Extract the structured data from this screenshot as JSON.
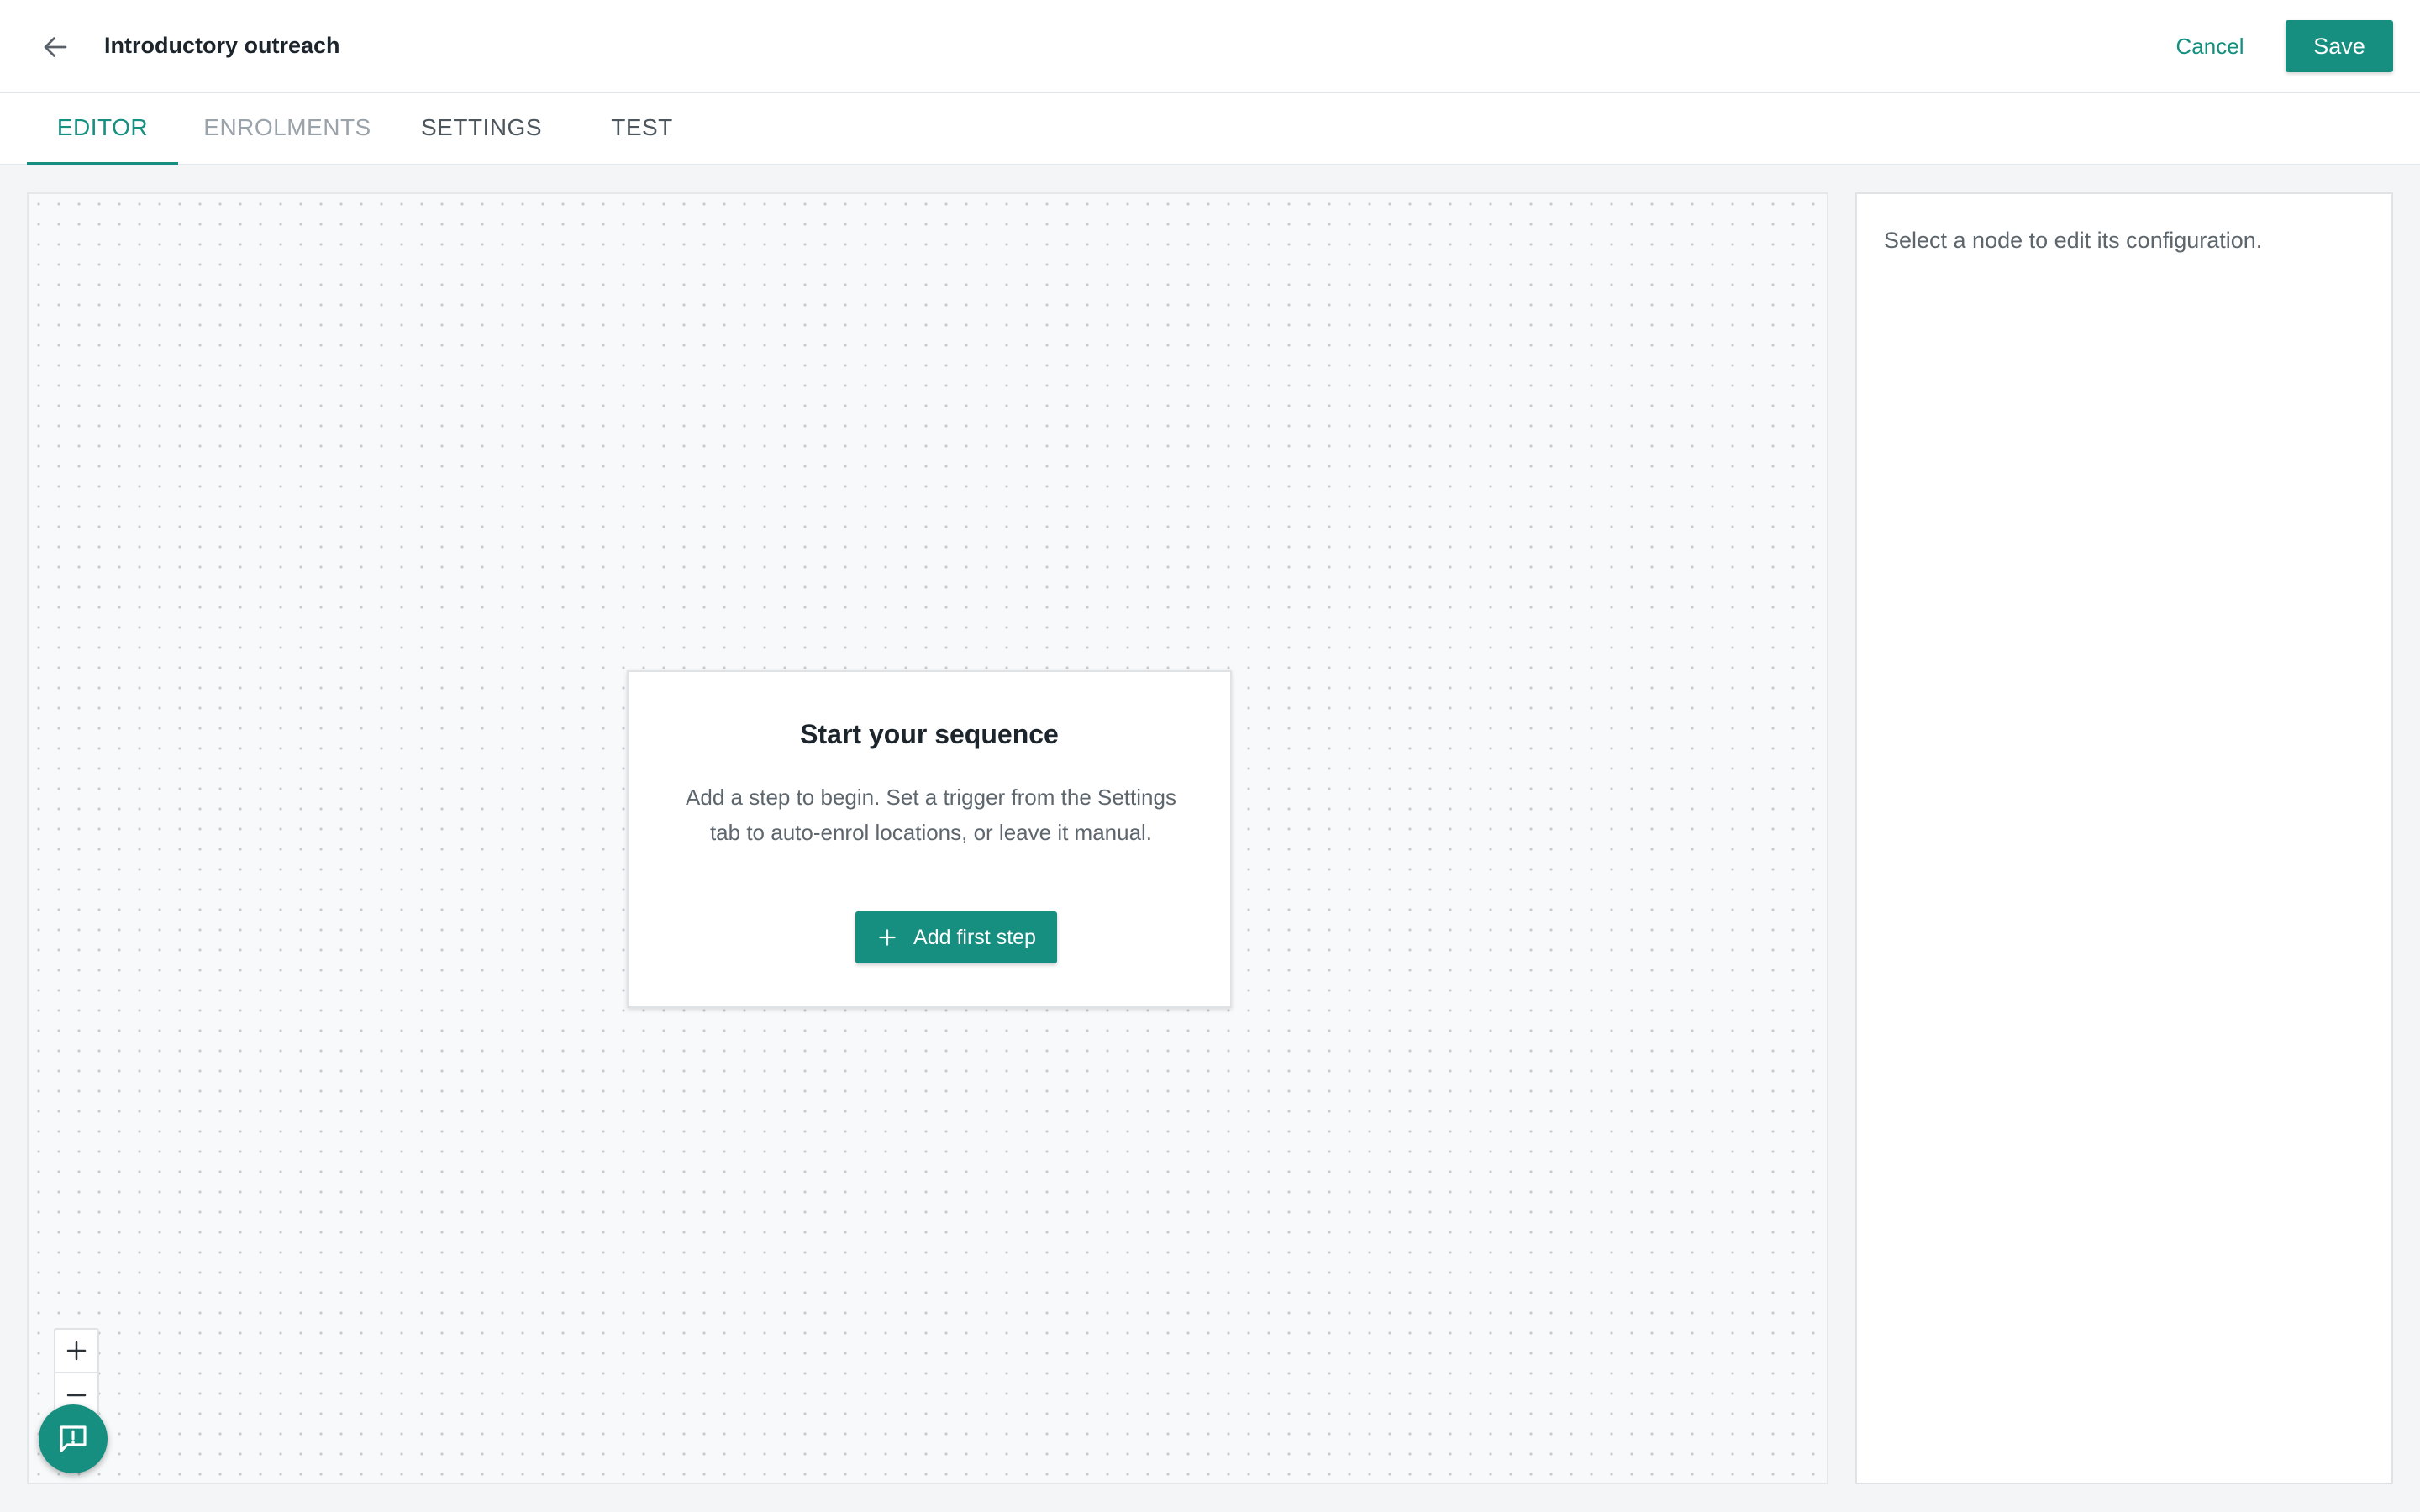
{
  "header": {
    "back_icon": "arrow-left-icon",
    "title": "Introductory outreach",
    "cancel_label": "Cancel",
    "save_label": "Save"
  },
  "tabs": [
    {
      "label": "EDITOR",
      "active": true
    },
    {
      "label": "ENROLMENTS",
      "active": false
    },
    {
      "label": "SETTINGS",
      "active": false
    },
    {
      "label": "TEST",
      "active": false
    }
  ],
  "canvas": {
    "start_card": {
      "title": "Start your sequence",
      "description": "Add a step to begin. Set a trigger from the Settings tab to auto-enrol locations, or leave it manual.",
      "button_label": "Add first step",
      "button_icon": "plus-icon"
    },
    "zoom": {
      "zoom_in_icon": "plus-icon",
      "zoom_out_icon": "minus-icon"
    },
    "feedback_icon": "feedback-icon"
  },
  "side_panel": {
    "hint": "Select a node to edit its configuration."
  },
  "colors": {
    "accent": "#178f80",
    "canvas_bg": "#f7f9fa",
    "text_dark": "#1d252c",
    "text_muted": "#5d666d"
  }
}
